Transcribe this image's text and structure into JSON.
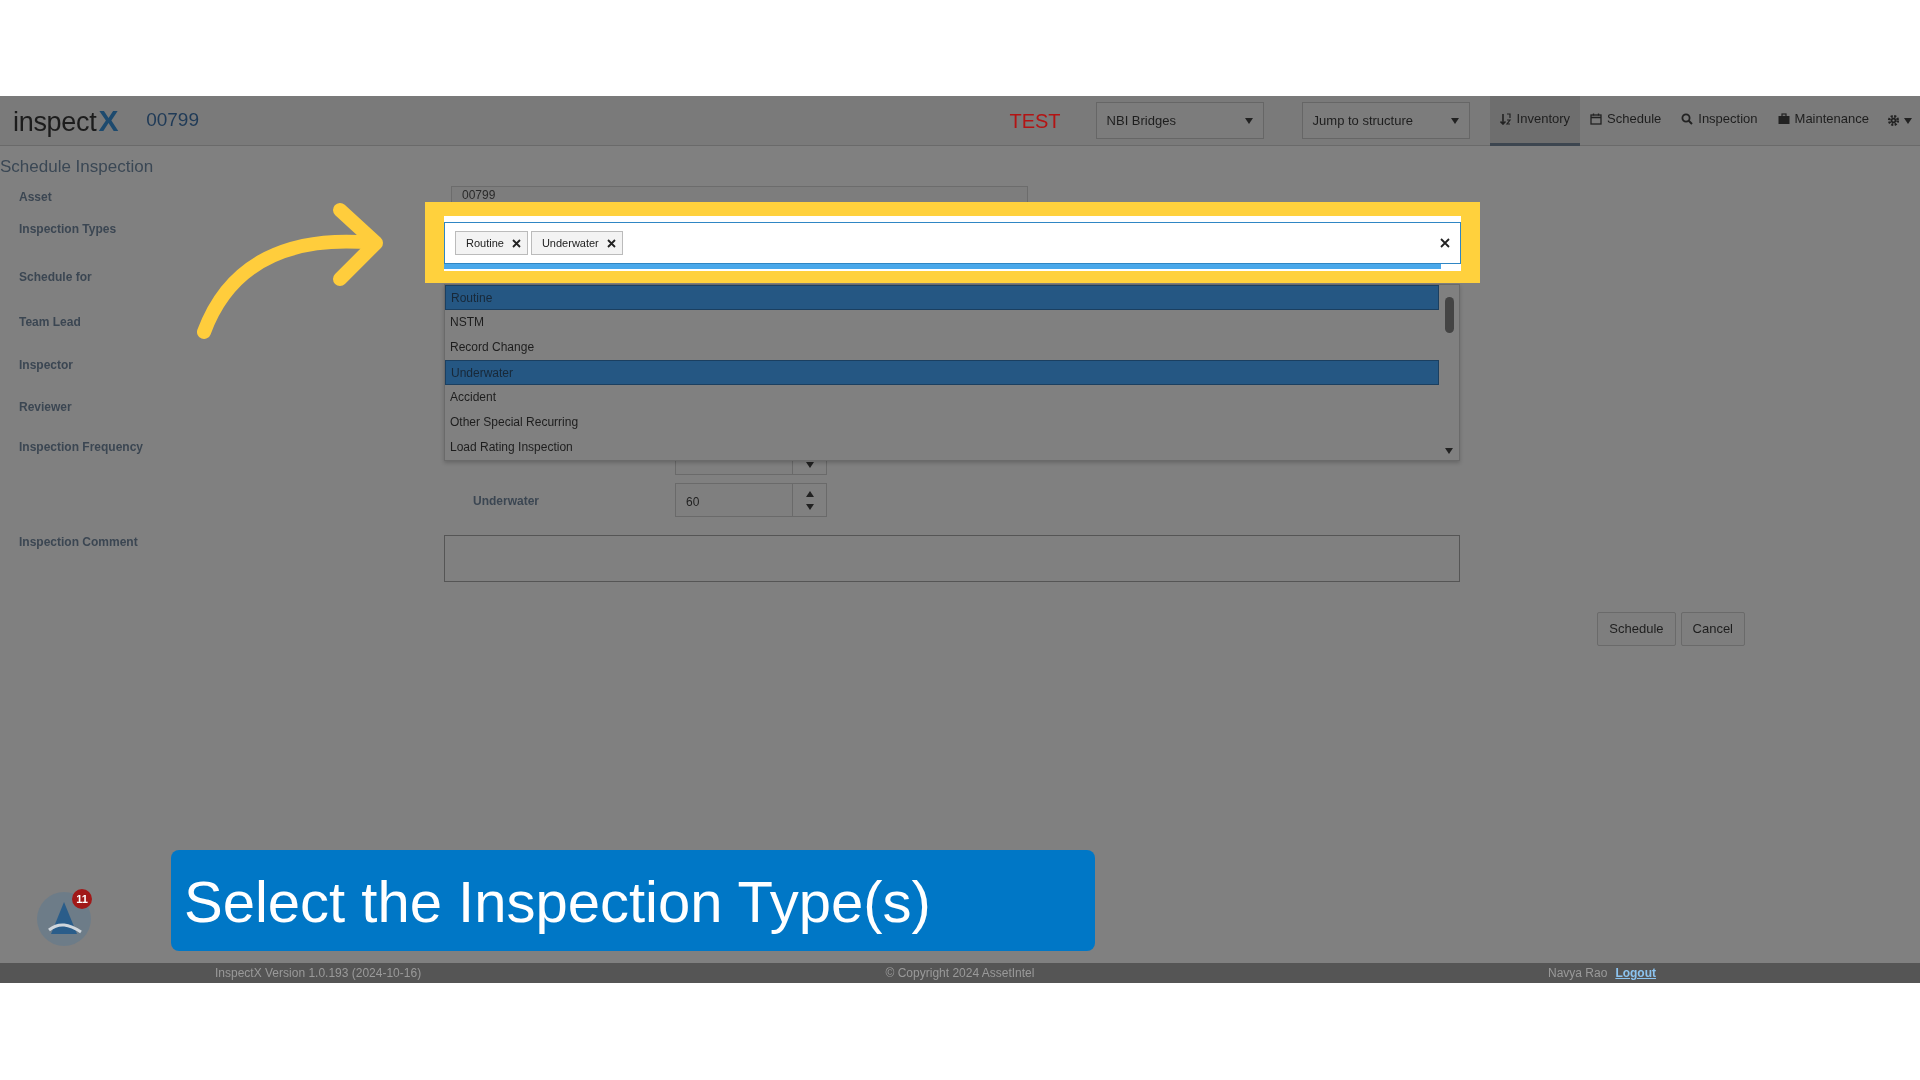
{
  "header": {
    "logo": {
      "text": "inspect",
      "mark": "X"
    },
    "asset_id": "00799",
    "environment": "TEST",
    "dataset_select": {
      "value": "NBI Bridges"
    },
    "jump_select": {
      "value": "Jump to structure"
    },
    "nav": [
      {
        "kind": "sort",
        "label": "Inventory",
        "selected": true
      },
      {
        "kind": "calendar",
        "label": "Schedule",
        "selected": false
      },
      {
        "kind": "search",
        "label": "Inspection",
        "selected": false
      },
      {
        "kind": "briefcase",
        "label": "Maintenance",
        "selected": false
      }
    ]
  },
  "page_title": "Schedule Inspection",
  "form": {
    "labels": [
      "Asset",
      "Inspection Types",
      "Schedule for",
      "Team Lead",
      "Inspector",
      "Reviewer",
      "Inspection Frequency",
      "Inspection Comment"
    ],
    "asset_value": "00799",
    "inspection_types": {
      "tags": [
        "Routine",
        "Underwater"
      ],
      "options": [
        {
          "label": "Routine",
          "selected": true
        },
        {
          "label": "NSTM",
          "selected": false
        },
        {
          "label": "Record Change",
          "selected": false
        },
        {
          "label": "Underwater",
          "selected": true
        },
        {
          "label": "Accident",
          "selected": false
        },
        {
          "label": "Other Special Recurring",
          "selected": false
        },
        {
          "label": "Load Rating Inspection",
          "selected": false
        }
      ]
    },
    "frequency": [
      {
        "label": "Underwater",
        "value": "60"
      }
    ]
  },
  "actions": [
    "Schedule",
    "Cancel"
  ],
  "chat": {
    "badge": "11"
  },
  "caption": "Select the Inspection Type(s)",
  "footer": {
    "version": "InspectX Version 1.0.193 (2024-10-16)",
    "copyright": "© Copyright 2024 AssetIntel",
    "user": "Navya Rao",
    "logout": "Logout"
  }
}
